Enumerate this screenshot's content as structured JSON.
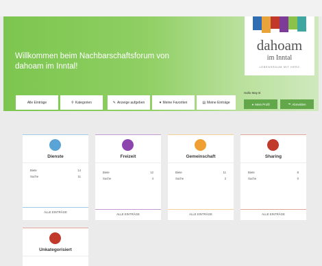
{
  "hero": {
    "title": "Willkommen beim Nachbarschaftsforum von dahoam im Inntal!"
  },
  "logo": {
    "word": "dahoam",
    "sub": "im Inntal",
    "tagline": "LEBENSRAUM MIT HERZ",
    "stripe_colors": [
      "#2e6db4",
      "#e8a33a",
      "#c0392b",
      "#7d3c98",
      "#8bc34a",
      "#3fa7a0"
    ]
  },
  "nav": {
    "all_entries": "Alle Einträge",
    "categories": "Kategorien",
    "post_ad": "Anzeige aufgeben",
    "favorites": "Meine Favoriten",
    "my_entries": "Meine Einträge"
  },
  "account": {
    "greeting": "Hallo May B",
    "profile": "Mein Profil",
    "logout": "Abmelden"
  },
  "labels": {
    "offer": "Biete",
    "search": "Suche",
    "all_entries_footer": "ALLE EINTRÄGE"
  },
  "categories": [
    {
      "name": "Dienste",
      "color": "#5aa3d6",
      "offer": "14",
      "search": "11",
      "border": "#9fc9e6"
    },
    {
      "name": "Freizeit",
      "color": "#8e44ad",
      "offer": "12",
      "search": "4",
      "border": "#c39bd3"
    },
    {
      "name": "Gemeinschaft",
      "color": "#f0a033",
      "offer": "11",
      "search": "2",
      "border": "#f5cf93"
    },
    {
      "name": "Sharing",
      "color": "#c0392b",
      "offer": "8",
      "search": "0",
      "border": "#e2a39b"
    },
    {
      "name": "Unkategorisiert",
      "color": "#c0392b",
      "border": "#e2a39b"
    }
  ]
}
